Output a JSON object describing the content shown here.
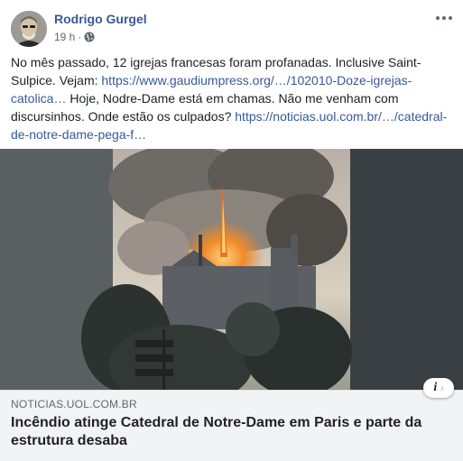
{
  "post": {
    "author": "Rodrigo Gurgel",
    "time": "19 h",
    "separator": "·",
    "privacy_icon": "globe-icon",
    "more_icon": "more-options-icon",
    "text_segments": {
      "t1": "No mês passado, 12 igrejas francesas foram profanadas. Inclusive Saint-Sulpice. Vejam: ",
      "link1": "https://www.gaudiumpress.org/…/102010-Doze-igrejas-catolica…",
      "t2": " Hoje, Nodre-Dame está em chamas. Não me venham com discursinhos. Onde estão os culpados? ",
      "link2": "https://noticias.uol.com.br/…/catedral-de-notre-dame-pega-f…"
    }
  },
  "link_preview": {
    "domain": "NOTICIAS.UOL.COM.BR",
    "title": "Incêndio atinge Catedral de Notre-Dame em Paris e parte da estrutura desaba",
    "info_label": "i",
    "chevron": "›",
    "image_icon": "cathedral-fire-photo"
  }
}
